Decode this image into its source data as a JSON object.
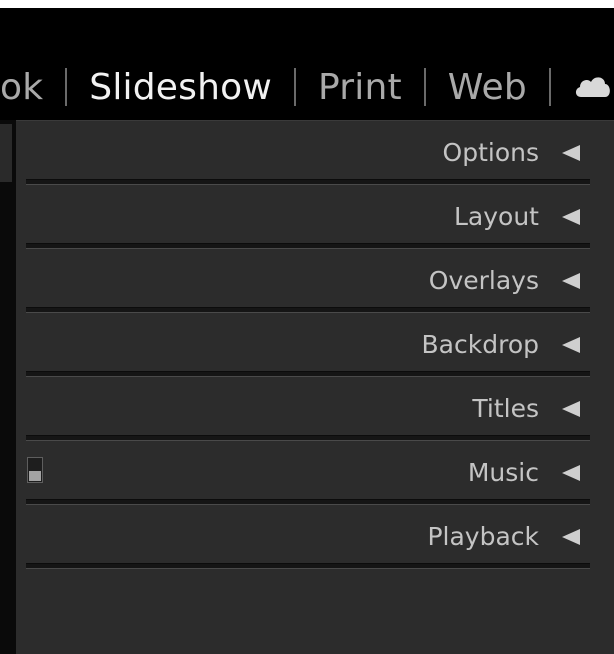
{
  "module_picker": {
    "items": [
      {
        "label": "ok",
        "active": false
      },
      {
        "label": "Slideshow",
        "active": true
      },
      {
        "label": "Print",
        "active": false
      },
      {
        "label": "Web",
        "active": false
      }
    ],
    "cloud_icon": "cloud-icon"
  },
  "right_panel": {
    "sections": [
      {
        "label": "Options",
        "state": "collapsed",
        "icon": "collapse-triangle-icon"
      },
      {
        "label": "Layout",
        "state": "collapsed",
        "icon": "collapse-triangle-icon"
      },
      {
        "label": "Overlays",
        "state": "collapsed",
        "icon": "collapse-triangle-icon"
      },
      {
        "label": "Backdrop",
        "state": "collapsed",
        "icon": "collapse-triangle-icon"
      },
      {
        "label": "Titles",
        "state": "collapsed",
        "icon": "collapse-triangle-icon"
      },
      {
        "label": "Music",
        "state": "collapsed",
        "icon": "collapse-triangle-icon",
        "enabled": false
      },
      {
        "label": "Playback",
        "state": "collapsed",
        "icon": "collapse-triangle-icon"
      }
    ]
  },
  "colors": {
    "module_bar_bg": "#000000",
    "panel_bg": "#2c2c2c",
    "active_text": "#f2f2f2",
    "inactive_text": "#a9a9a9",
    "section_text": "#c4c4c4"
  }
}
